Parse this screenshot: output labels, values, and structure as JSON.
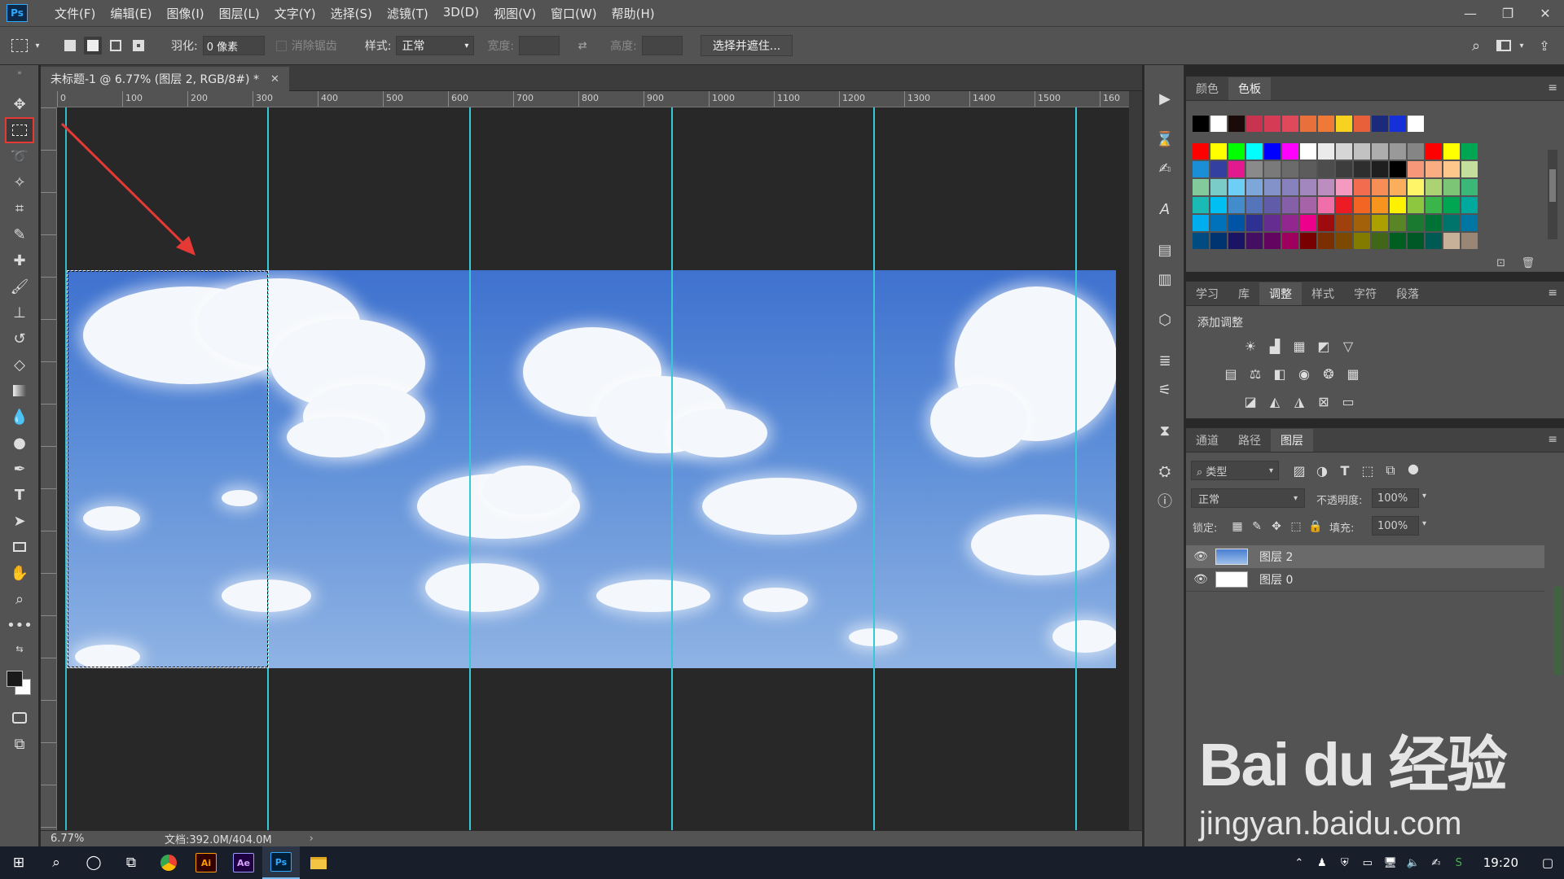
{
  "app": {
    "logo": "Ps"
  },
  "menu": [
    "文件(F)",
    "编辑(E)",
    "图像(I)",
    "图层(L)",
    "文字(Y)",
    "选择(S)",
    "滤镜(T)",
    "3D(D)",
    "视图(V)",
    "窗口(W)",
    "帮助(H)"
  ],
  "options_bar": {
    "feather_label": "羽化:",
    "feather_value": "0 像素",
    "antialias_label": "消除锯齿",
    "style_label": "样式:",
    "style_value": "正常",
    "width_label": "宽度:",
    "height_label": "高度:",
    "select_mask_button": "选择并遮住..."
  },
  "document": {
    "tab_title": "未标题-1 @ 6.77% (图层 2, RGB/8#) *",
    "zoom": "6.77%",
    "doc_size": "文档:392.0M/404.0M"
  },
  "ruler_h_labels": [
    "0",
    "100",
    "200",
    "300",
    "400",
    "500",
    "600",
    "700",
    "800",
    "900",
    "1000",
    "1100",
    "1200",
    "1300",
    "1400",
    "1500",
    "160"
  ],
  "panels": {
    "color_tabs": [
      "颜色",
      "色板"
    ],
    "adjust_tabs": [
      "学习",
      "库",
      "调整",
      "样式",
      "字符",
      "段落"
    ],
    "adjust_title": "添加调整",
    "layer_tabs": [
      "通道",
      "路径",
      "图层"
    ],
    "filter_kind": "类型",
    "blend_mode": "正常",
    "opacity_label": "不透明度:",
    "opacity_value": "100%",
    "lock_label": "锁定:",
    "fill_label": "填充:",
    "fill_value": "100%",
    "layers": [
      {
        "name": "图层 2",
        "selected": true
      },
      {
        "name": "图层 0",
        "selected": false
      }
    ]
  },
  "swatch_colors": {
    "recent": [
      "#000000",
      "#ffffff",
      "#1a0a0a",
      "#c8344f",
      "#d63b55",
      "#e0495b",
      "#e8703b",
      "#ef7a37",
      "#f7d21e",
      "#e8603a",
      "#1b2a7a",
      "#1530d8",
      "#ffffff"
    ],
    "grid": [
      [
        "#ff0000",
        "#ffff00",
        "#00ff00",
        "#00ffff",
        "#0000ff",
        "#ff00ff",
        "#ffffff",
        "#ebebeb",
        "#d6d6d6",
        "#c2c2c2",
        "#adadad",
        "#999999",
        "#858585",
        "#ff0000",
        "#ffff00",
        "#00a651"
      ],
      [
        "#1a8fd8",
        "#3340a0",
        "#e31a8f",
        "#8a8a8a",
        "#7a7a7a",
        "#6b6b6b",
        "#5c5c5c",
        "#4d4d4d",
        "#3d3d3d",
        "#2e2e2e",
        "#1f1f1f",
        "#000000",
        "#f7977a",
        "#f9ad81",
        "#fdc68a",
        "#c4df9b"
      ],
      [
        "#82ca9c",
        "#7accc8",
        "#6dcff6",
        "#7da7d9",
        "#8393ca",
        "#8781bd",
        "#a187be",
        "#bc8dbf",
        "#f49ac1",
        "#f26c4f",
        "#f68e56",
        "#fbaf5d",
        "#fff568",
        "#acd373",
        "#7cc576",
        "#3bb878"
      ],
      [
        "#1abbb4",
        "#00bff3",
        "#438ccb",
        "#5574b9",
        "#605ca8",
        "#855fa8",
        "#a763a8",
        "#f06eaa",
        "#ed1c24",
        "#f26522",
        "#f7941d",
        "#fff200",
        "#8dc63f",
        "#39b54a",
        "#00a651",
        "#00a99d"
      ],
      [
        "#00aeef",
        "#0072bc",
        "#0054a6",
        "#2e3192",
        "#662d91",
        "#92278f",
        "#ec008c",
        "#9e0b0f",
        "#a0410d",
        "#a36209",
        "#aba000",
        "#598527",
        "#1a7b30",
        "#007236",
        "#00746b",
        "#0076a3"
      ],
      [
        "#004b80",
        "#003471",
        "#1b1464",
        "#440e62",
        "#630460",
        "#9e005d",
        "#790000",
        "#7b2e00",
        "#7d4900",
        "#827b00",
        "#406618",
        "#005e20",
        "#005826",
        "#005952",
        "#c7b299",
        "#998675"
      ]
    ]
  },
  "watermark": {
    "logo": "Bai du 经验",
    "url": "jingyan.baidu.com"
  },
  "taskbar": {
    "time": "19:20",
    "apps": [
      "Ai",
      "Ae",
      "Ps"
    ]
  }
}
